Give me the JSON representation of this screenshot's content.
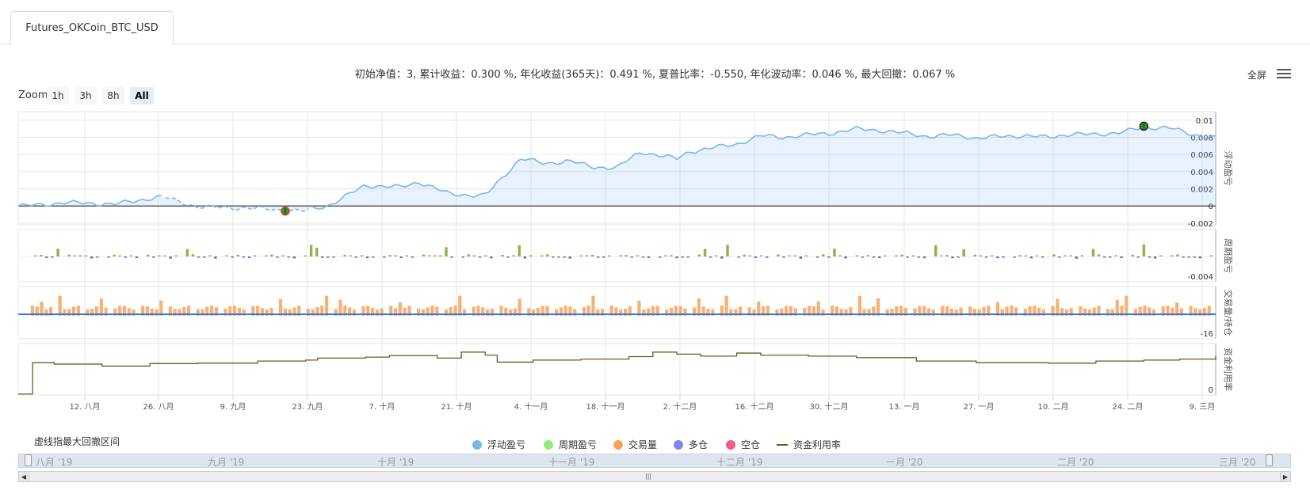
{
  "tab": {
    "label": "Futures_OKCoin_BTC_USD"
  },
  "stats_line": "初始净值：3, 累计收益：0.300 %, 年化收益(365天)：0.491 %, 夏普比率：-0.550, 年化波动率：0.046 %, 最大回撤：0.067 %",
  "toolbar": {
    "fullscreen": "全屏",
    "zoom_label": "Zoom",
    "zoom_buttons": [
      "1h",
      "3h",
      "8h",
      "All"
    ],
    "zoom_selected": "All"
  },
  "drawdown_note": "虚线指最大回撤区间",
  "colors": {
    "float_pnl": "#7cb5ec",
    "period_up": "#8cb34e",
    "period_down": "#7b5ea7",
    "volume": "#f7a35c",
    "long": "#8085e9",
    "short": "#f15c80",
    "usage": "#6b5a1f"
  },
  "chart_data": {
    "type": "line",
    "x_ticks": [
      "12. 八月",
      "26. 八月",
      "9. 九月",
      "23. 九月",
      "7. 十月",
      "21. 十月",
      "4. 十一月",
      "18. 十一月",
      "2. 十二月",
      "16. 十二月",
      "30. 十二月",
      "13. 一月",
      "27. 一月",
      "10. 二月",
      "24. 二月",
      "9. 三月"
    ],
    "legend": [
      {
        "name": "浮动盈亏",
        "kind": "dot",
        "color": "#7cb5ec"
      },
      {
        "name": "周期盈亏",
        "kind": "dot",
        "color": "#90ed7d"
      },
      {
        "name": "交易量",
        "kind": "dot",
        "color": "#f7a35c"
      },
      {
        "name": "多仓",
        "kind": "dot",
        "color": "#8085e9"
      },
      {
        "name": "空仓",
        "kind": "dot",
        "color": "#f15c80"
      },
      {
        "name": "资金利用率",
        "kind": "line",
        "color": "#6b5a1f"
      }
    ],
    "panes": [
      {
        "ylabel": "浮动盈亏",
        "yticks": [
          "0.01",
          "0.008",
          "0.006",
          "0.004",
          "0.002",
          "0",
          "-0.002"
        ],
        "ylim": [
          -0.0022,
          0.011
        ]
      },
      {
        "ylabel": "周期盈亏",
        "yticks": [
          "-0.004"
        ]
      },
      {
        "ylabel": "交易量/持仓",
        "yticks": [
          "-16"
        ]
      },
      {
        "ylabel": "资金利用率",
        "yticks": [
          "0"
        ]
      }
    ],
    "float_pnl": {
      "x": [
        0,
        0.015,
        0.04,
        0.08,
        0.12,
        0.15,
        0.2,
        0.24,
        0.26,
        0.29,
        0.32,
        0.335,
        0.36,
        0.39,
        0.42,
        0.44,
        0.46,
        0.48,
        0.5,
        0.52,
        0.54,
        0.55,
        0.56,
        0.58,
        0.6,
        0.62,
        0.64,
        0.66,
        0.68,
        0.7,
        0.72,
        0.74,
        0.76,
        0.78,
        0.8,
        0.82,
        0.84,
        0.86,
        0.88,
        0.9,
        0.92,
        0.94,
        0.96,
        0.98,
        1.0
      ],
      "y": [
        0,
        0.0001,
        0.0004,
        0.0002,
        0.0011,
        -0.0001,
        -0.0003,
        -0.0006,
        0.0001,
        0.0024,
        0.0022,
        0.0028,
        0.0014,
        0.0012,
        0.0056,
        0.0049,
        0.0053,
        0.0045,
        0.0045,
        0.0063,
        0.0058,
        0.0055,
        0.0063,
        0.0068,
        0.0072,
        0.0082,
        0.008,
        0.0083,
        0.0085,
        0.009,
        0.0088,
        0.0085,
        0.0081,
        0.0083,
        0.0079,
        0.0081,
        0.0082,
        0.008,
        0.0084,
        0.0083,
        0.0086,
        0.0091,
        0.0092,
        0.0083,
        0.008
      ],
      "drawdown_range": [
        0.12,
        0.245
      ],
      "markers": [
        {
          "x": 0.223,
          "y": -0.0006,
          "kind": "low"
        },
        {
          "x": 0.94,
          "y": 0.0093,
          "kind": "high"
        }
      ]
    },
    "capital_usage": {
      "x": [
        0,
        0.012,
        0.03,
        0.07,
        0.11,
        0.15,
        0.2,
        0.24,
        0.25,
        0.29,
        0.31,
        0.35,
        0.37,
        0.39,
        0.4,
        0.43,
        0.47,
        0.51,
        0.53,
        0.55,
        0.57,
        0.6,
        0.62,
        0.66,
        0.7,
        0.75,
        0.8,
        0.86,
        0.9,
        0.94,
        0.97,
        1.0
      ],
      "y": [
        0.02,
        0.65,
        0.62,
        0.58,
        0.63,
        0.64,
        0.68,
        0.7,
        0.74,
        0.76,
        0.79,
        0.74,
        0.86,
        0.8,
        0.66,
        0.7,
        0.72,
        0.77,
        0.86,
        0.82,
        0.78,
        0.84,
        0.8,
        0.78,
        0.75,
        0.68,
        0.65,
        0.64,
        0.68,
        0.7,
        0.72,
        0.78
      ]
    }
  },
  "navigator": {
    "labels": [
      "八月 '19",
      "九月 '19",
      "十月 '19",
      "十一月 '19",
      "十二月 '19",
      "一月 '20",
      "二月 '20",
      "三月 '20"
    ]
  }
}
